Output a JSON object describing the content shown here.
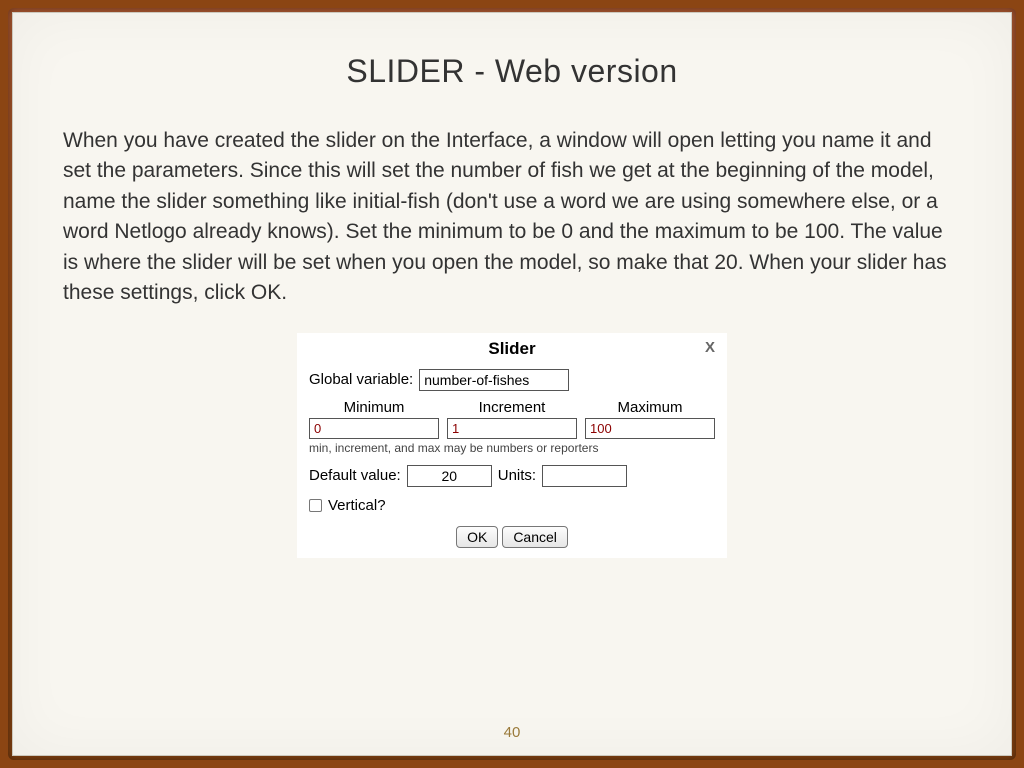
{
  "slide": {
    "title": "SLIDER - Web version",
    "body": "When you have created the slider on the Interface, a window will open letting you name it and set the parameters.  Since this will set the number of fish we get at the beginning of the model, name the slider something like initial-fish (don't use a word we are using somewhere else, or a word Netlogo already knows).  Set the minimum to be 0 and the maximum to be 100.  The value is where the slider will be set when you open the model, so make that 20.  When your slider has these settings, click OK.",
    "page_number": "40"
  },
  "dialog": {
    "title": "Slider",
    "close": "X",
    "global_var_label": "Global variable:",
    "global_var_value": "number-of-fishes",
    "min_label": "Minimum",
    "min_value": "0",
    "inc_label": "Increment",
    "inc_value": "1",
    "max_label": "Maximum",
    "max_value": "100",
    "hint": "min, increment, and max may be numbers or reporters",
    "default_label": "Default value:",
    "default_value": "20",
    "units_label": "Units:",
    "units_value": "",
    "vertical_label": "Vertical?",
    "ok": "OK",
    "cancel": "Cancel"
  }
}
